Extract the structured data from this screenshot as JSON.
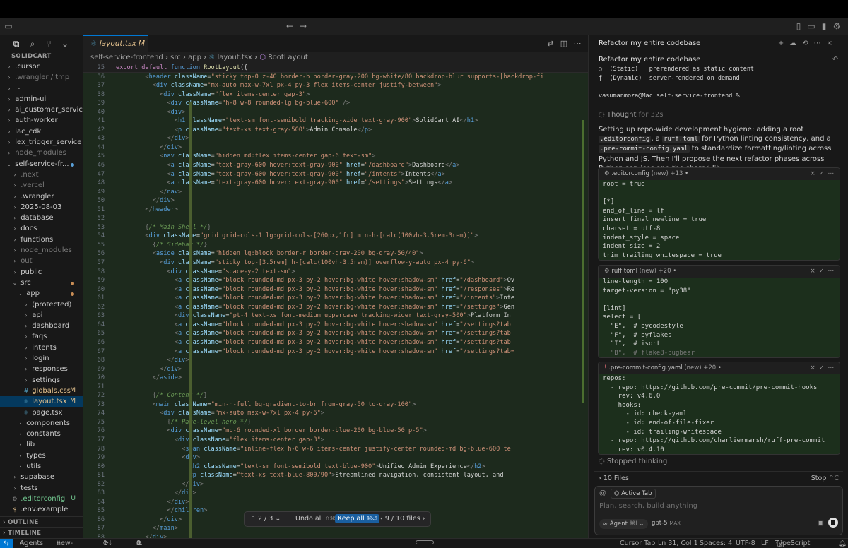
{
  "window": {
    "search": "solidcart"
  },
  "explorer": {
    "title": "SOLIDCART",
    "outline": "OUTLINE",
    "timeline": "TIMELINE",
    "items": [
      {
        "label": ".cursor",
        "d": 0,
        "c": "›"
      },
      {
        "label": ".wrangler / tmp",
        "d": 0,
        "c": "›",
        "dim": true
      },
      {
        "label": "~",
        "d": 0,
        "c": "›"
      },
      {
        "label": "admin-ui",
        "d": 0,
        "c": "›"
      },
      {
        "label": "ai_customer_service...",
        "d": 0,
        "c": "›"
      },
      {
        "label": "auth-worker",
        "d": 0,
        "c": "›"
      },
      {
        "label": "iac_cdk",
        "d": 0,
        "c": "›"
      },
      {
        "label": "lex_trigger_service",
        "d": 0,
        "c": "›"
      },
      {
        "label": "node_modules",
        "d": 0,
        "c": "›",
        "dim": true
      },
      {
        "label": "self-service-fr...",
        "d": 0,
        "c": "⌄",
        "dot": "#5aa0d8"
      },
      {
        "label": ".next",
        "d": 1,
        "c": "›",
        "dim": true
      },
      {
        "label": ".vercel",
        "d": 1,
        "c": "›",
        "dim": true
      },
      {
        "label": ".wrangler",
        "d": 1,
        "c": "›"
      },
      {
        "label": "2025-08-03",
        "d": 1,
        "c": "›"
      },
      {
        "label": "database",
        "d": 1,
        "c": "›"
      },
      {
        "label": "docs",
        "d": 1,
        "c": "›"
      },
      {
        "label": "functions",
        "d": 1,
        "c": "›"
      },
      {
        "label": "node_modules",
        "d": 1,
        "c": "›",
        "dim": true
      },
      {
        "label": "out",
        "d": 1,
        "c": "›",
        "dim": true
      },
      {
        "label": "public",
        "d": 1,
        "c": "›"
      },
      {
        "label": "src",
        "d": 1,
        "c": "⌄",
        "dot": "#c98d55"
      },
      {
        "label": "app",
        "d": 2,
        "c": "⌄",
        "dot": "#c98d55"
      },
      {
        "label": "(protected)",
        "d": 3,
        "c": "›"
      },
      {
        "label": "api",
        "d": 3,
        "c": "›"
      },
      {
        "label": "dashboard",
        "d": 3,
        "c": "›"
      },
      {
        "label": "faqs",
        "d": 3,
        "c": "›"
      },
      {
        "label": "intents",
        "d": 3,
        "c": "›"
      },
      {
        "label": "login",
        "d": 3,
        "c": "›"
      },
      {
        "label": "responses",
        "d": 3,
        "c": "›"
      },
      {
        "label": "settings",
        "d": 3,
        "c": "›"
      },
      {
        "label": "globals.css",
        "d": 3,
        "c": "#",
        "badge": "M",
        "mod": true
      },
      {
        "label": "layout.tsx",
        "d": 3,
        "c": "⚛",
        "badge": "M",
        "mod": true,
        "sel": true
      },
      {
        "label": "page.tsx",
        "d": 3,
        "c": "⚛"
      },
      {
        "label": "components",
        "d": 2,
        "c": "›"
      },
      {
        "label": "constants",
        "d": 2,
        "c": "›"
      },
      {
        "label": "lib",
        "d": 2,
        "c": "›"
      },
      {
        "label": "types",
        "d": 2,
        "c": "›"
      },
      {
        "label": "utils",
        "d": 2,
        "c": "›"
      },
      {
        "label": "supabase",
        "d": 1,
        "c": "›"
      },
      {
        "label": "tests",
        "d": 1,
        "c": "›"
      },
      {
        "label": ".editorconfig",
        "d": 1,
        "c": "⚙",
        "badge": "U",
        "add": true
      },
      {
        "label": ".env.example",
        "d": 1,
        "c": "$"
      }
    ]
  },
  "editor": {
    "tab": "layout.tsx",
    "tab_badge": "M",
    "crumbs": [
      "self-service-frontend",
      "src",
      "app",
      "layout.tsx",
      "RootLayout"
    ],
    "sticky": "export default function RootLayout({"
  },
  "review": {
    "hunks": "2 / 3",
    "undo": "Undo all",
    "undo_kbd": "⇧⌘⌫",
    "keep": "Keep all",
    "keep_kbd": "⌘⏎",
    "files": "9 / 10 files"
  },
  "status": {
    "agents": "Agents",
    "branch": "new-design*",
    "sync": "1↓ 0↑",
    "problems": "0",
    "warnings": "0",
    "cursor_tab": "Cursor Tab",
    "pos": "Ln 31, Col 1",
    "spaces": "Spaces: 4",
    "enc": "UTF-8",
    "eol": "LF",
    "lang": "TypeScript JSX"
  },
  "chat": {
    "title": "Refactor my entire codebase",
    "subtitle": "Refactor my entire codebase",
    "term": [
      "○  (Static)   prerendered as static content",
      "ƒ  (Dynamic)  server-rendered on demand",
      "",
      "vasumanmoza@Mac self-service-frontend %"
    ],
    "thought": "Thought",
    "thought_time": "for 32s",
    "msg_parts": [
      "Setting up repo-wide development hygiene: adding a root ",
      ".editorconfig",
      ", a ",
      "ruff.toml",
      " for Python linting consistency, and a ",
      ".pre-commit-config.yaml",
      " to standardize formatting/linting across Python and JS. Then I'll propose the next refactor phases across Python services and the shared lib."
    ],
    "files": [
      {
        "name": ".editorconfig",
        "tag": "(new)",
        "count": "+13",
        "lines": [
          "root = true",
          "",
          "[*]",
          "end_of_line = lf",
          "insert_final_newline = true",
          "charset = utf-8",
          "indent_style = space",
          "indent_size = 2",
          "trim_trailing_whitespace = true"
        ]
      },
      {
        "name": "ruff.toml",
        "tag": "(new)",
        "count": "+20",
        "lines": [
          "line-length = 100",
          "target-version = \"py38\"",
          "",
          "[lint]",
          "select = [",
          "  \"E\",  # pycodestyle",
          "  \"F\",  # pyflakes",
          "  \"I\",  # isort",
          "  \"B\",  # flake8-bugbear"
        ]
      },
      {
        "name": ".pre-commit-config.yaml",
        "tag": "(new)",
        "count": "+20",
        "lines": [
          "repos:",
          "  - repo: https://github.com/pre-commit/pre-commit-hooks",
          "    rev: v4.6.0",
          "    hooks:",
          "      - id: check-yaml",
          "      - id: end-of-file-fixer",
          "      - id: trailing-whitespace",
          "  - repo: https://github.com/charliermarsh/ruff-pre-commit",
          "    rev: v0.4.10"
        ]
      }
    ],
    "stopped": "Stopped thinking",
    "files_count": "10 Files",
    "stop": "Stop",
    "stop_kbd": "^C",
    "context": "Active Tab",
    "placeholder": "Plan, search, build anything",
    "agent": "Agent",
    "agent_kbd": "⌘I",
    "model": "gpt-5",
    "model_tag": "MAX"
  }
}
